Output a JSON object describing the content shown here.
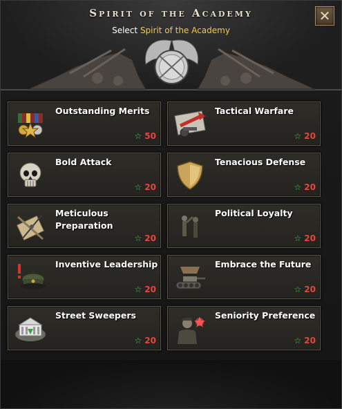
{
  "window": {
    "title": "Spirit of the Academy",
    "subtitle_prefix": "Select",
    "subtitle_highlight": "Spirit of the Academy",
    "close_label": "✕"
  },
  "colors": {
    "title": "#e6e0cc",
    "highlight": "#f2c94c",
    "cost_star": "#3fd24b",
    "cost_value": "#e8453c"
  },
  "spirits": [
    {
      "name": "Outstanding Merits",
      "cost": "50",
      "icon": "medals-icon"
    },
    {
      "name": "Tactical Warfare",
      "cost": "20",
      "icon": "artillery-map-icon"
    },
    {
      "name": "Bold Attack",
      "cost": "20",
      "icon": "skull-icon"
    },
    {
      "name": "Tenacious Defense",
      "cost": "20",
      "icon": "shield-icon"
    },
    {
      "name": "Meticulous Preparation",
      "cost": "20",
      "icon": "map-compass-icon"
    },
    {
      "name": "Political Loyalty",
      "cost": "20",
      "icon": "saluting-figures-icon"
    },
    {
      "name": "Inventive Leadership",
      "cost": "20",
      "icon": "officer-cap-icon"
    },
    {
      "name": "Embrace the Future",
      "cost": "20",
      "icon": "tank-icon"
    },
    {
      "name": "Street Sweepers",
      "cost": "20",
      "icon": "government-building-icon"
    },
    {
      "name": "Seniority Preference",
      "cost": "20",
      "icon": "veteran-officer-icon"
    }
  ]
}
